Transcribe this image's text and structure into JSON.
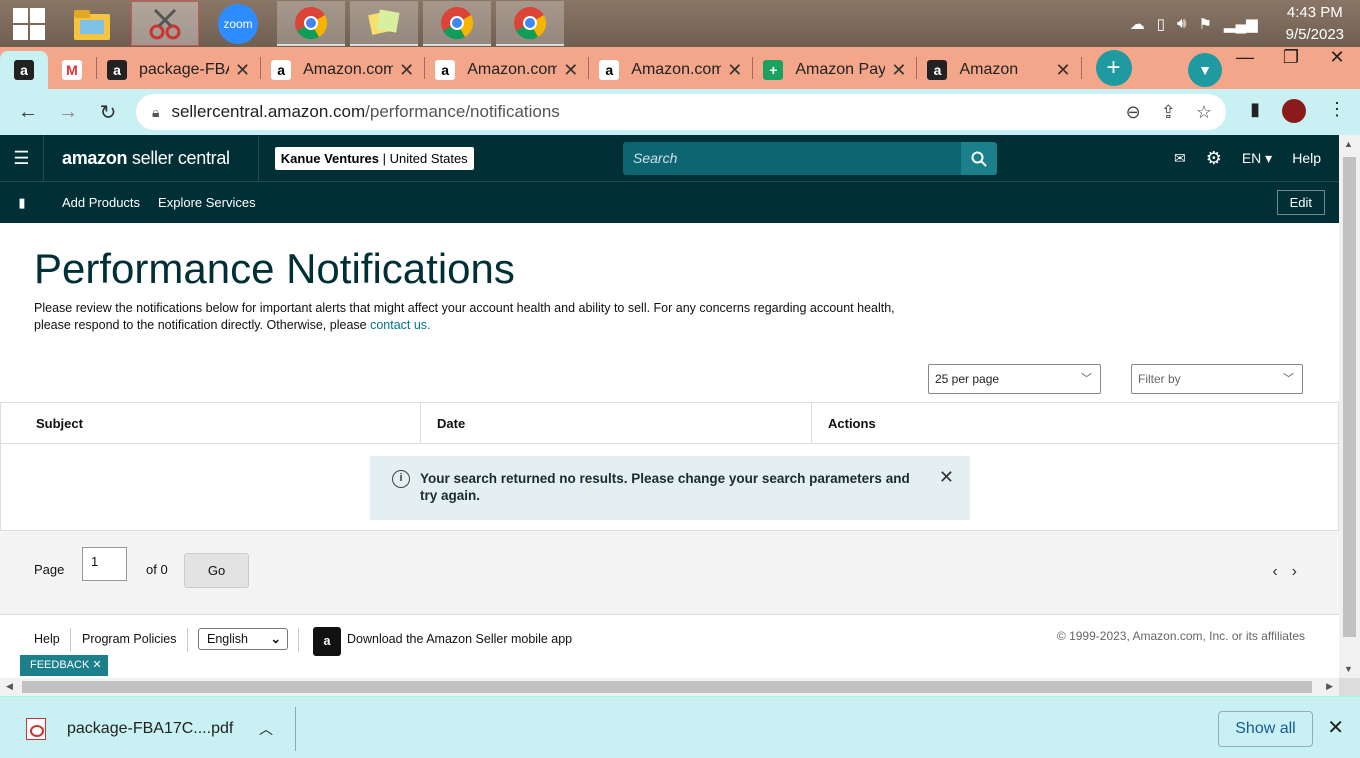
{
  "taskbar": {
    "clock_time": "4:43 PM",
    "clock_date": "9/5/2023",
    "apps": [
      "file-explorer",
      "snipping-tool",
      "zoom",
      "chrome",
      "sticky-notes",
      "chrome",
      "chrome"
    ],
    "zoom_label": "zoom"
  },
  "browser": {
    "tabs": [
      {
        "label": "",
        "fav": "a",
        "fav_bg": "#222"
      },
      {
        "label": "",
        "fav": "M",
        "fav_bg": "#fff"
      },
      {
        "label": "package-FBA",
        "fav": "a",
        "fav_bg": "#222"
      },
      {
        "label": "Amazon.com",
        "fav": "a",
        "fav_bg": "#fff"
      },
      {
        "label": "Amazon.com",
        "fav": "a",
        "fav_bg": "#fff"
      },
      {
        "label": "Amazon.com",
        "fav": "a",
        "fav_bg": "#fff"
      },
      {
        "label": "Amazon Pay",
        "fav": "+",
        "fav_bg": "#1aa260"
      },
      {
        "label": "Amazon",
        "fav": "a",
        "fav_bg": "#222"
      }
    ],
    "url_host": "sellercentral.amazon.com",
    "url_path": "/performance/notifications"
  },
  "header": {
    "logo_main": "amazon",
    "logo_sub": " seller central",
    "store_name": "Kanue Ventures",
    "store_region": "United States",
    "search_placeholder": "Search",
    "lang": "EN",
    "help": "Help"
  },
  "subnav": {
    "add_products": "Add Products",
    "explore_services": "Explore Services",
    "edit": "Edit"
  },
  "main": {
    "title": "Performance Notifications",
    "description": "Please review the notifications below for important alerts that might affect your account health and ability to sell. For any concerns regarding account health, please respond to the notification directly. Otherwise, please ",
    "contact_link": "contact us.",
    "per_page": "25 per page",
    "filter_by": "Filter by",
    "columns": [
      "Subject",
      "Date",
      "Actions"
    ],
    "alert_text": "Your search returned no results. Please change your search parameters and try again.",
    "pager_label": "Page",
    "pager_value": "1",
    "pager_of": "of 0",
    "go": "Go"
  },
  "footer": {
    "help": "Help",
    "program_policies": "Program Policies",
    "language": "English",
    "app_download": "Download the Amazon Seller mobile app",
    "copyright": "© 1999-2023, Amazon.com, Inc. or its affiliates",
    "feedback": "FEEDBACK"
  },
  "downloads": {
    "file": "package-FBA17C....pdf",
    "show_all": "Show all"
  }
}
